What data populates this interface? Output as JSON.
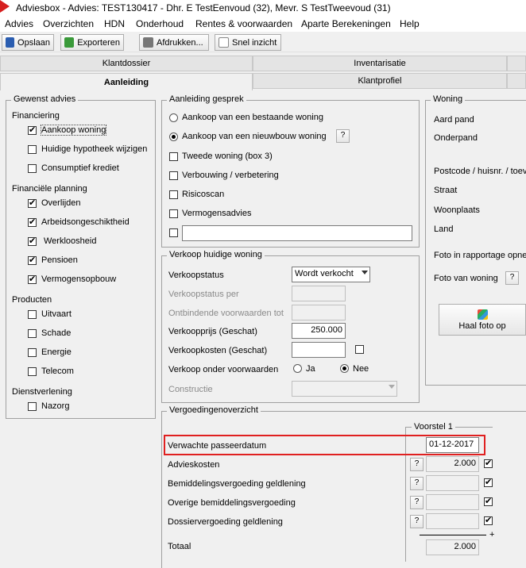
{
  "window": {
    "title": "Adviesbox - Advies: TEST130417 - Dhr. E TestEenvoud (32), Mevr. S TestTweevoud (31)"
  },
  "menu": [
    "Advies",
    "Overzichten",
    "HDN",
    "Onderhoud",
    "Rentes & voorwaarden",
    "Aparte Berekeningen",
    "Help"
  ],
  "toolbar": {
    "save": "Opslaan",
    "export": "Exporteren",
    "print": "Afdrukken...",
    "quick": "Snel inzicht"
  },
  "tabs": {
    "row1": [
      "Klantdossier",
      "Inventarisatie"
    ],
    "row2": [
      "Aanleiding",
      "Klantprofiel"
    ]
  },
  "gewenst": {
    "legend": "Gewenst advies",
    "sections": {
      "financiering": "Financiering",
      "planning": "Financiële planning",
      "producten": "Producten",
      "dienst": "Dienstverlening"
    },
    "items": [
      {
        "label": "Aankoop woning",
        "checked": true
      },
      {
        "label": "Huidige hypotheek wijzigen",
        "checked": false
      },
      {
        "label": "Consumptief krediet",
        "checked": false
      },
      {
        "label": "Overlijden",
        "checked": true
      },
      {
        "label": "Arbeidsongeschiktheid",
        "checked": true
      },
      {
        "label": "Werkloosheid",
        "checked": true
      },
      {
        "label": "Pensioen",
        "checked": true
      },
      {
        "label": "Vermogensopbouw",
        "checked": true
      },
      {
        "label": "Uitvaart",
        "checked": false
      },
      {
        "label": "Schade",
        "checked": false
      },
      {
        "label": "Energie",
        "checked": false
      },
      {
        "label": "Telecom",
        "checked": false
      },
      {
        "label": "Nazorg",
        "checked": false
      }
    ]
  },
  "gesprek": {
    "legend": "Aanleiding gesprek",
    "radio1": "Aankoop van een bestaande woning",
    "radio2": "Aankoop van een nieuwbouw woning",
    "chk1": "Tweede woning (box 3)",
    "chk2": "Verbouwing / verbetering",
    "chk3": "Risicoscan",
    "chk4": "Vermogensadvies",
    "help": "?"
  },
  "verkoop": {
    "legend": "Verkoop huidige woning",
    "status_label": "Verkoopstatus",
    "status_value": "Wordt verkocht",
    "status_per": "Verkoopstatus per",
    "ontbindende": "Ontbindende voorwaarden tot",
    "prijs_label": "Verkoopprijs (Geschat)",
    "prijs_value": "250.000",
    "kosten_label": "Verkoopkosten (Geschat)",
    "onder_label": "Verkoop onder voorwaarden",
    "ja": "Ja",
    "nee": "Nee",
    "constructie": "Constructie"
  },
  "woning": {
    "legend": "Woning",
    "aard": "Aard pand",
    "onderpand": "Onderpand",
    "postcode": "Postcode / huisnr. / toev",
    "straat": "Straat",
    "woonplaats": "Woonplaats",
    "land": "Land",
    "foto_rapport": "Foto in rapportage opne",
    "foto_woning": "Foto van woning",
    "haal_foto": "Haal foto op"
  },
  "vergoeding": {
    "legend": "Vergoedingenoverzicht",
    "voorstel": "Voorstel 1",
    "passeer_label": "Verwachte passeerdatum",
    "passeer_value": "01-12-2017",
    "advies_label": "Advieskosten",
    "advies_value": "2.000",
    "bemid_label": "Bemiddelingsvergoeding geldlening",
    "overig_label": "Overige bemiddelingsvergoeding",
    "dossier_label": "Dossiervergoeding geldlening",
    "totaal_label": "Totaal",
    "totaal_value": "2.000",
    "plus": "+"
  },
  "colors": {
    "highlight": "#e02020",
    "tab_bg": "#e4e4e4",
    "window_bg": "#f0f0f0"
  }
}
